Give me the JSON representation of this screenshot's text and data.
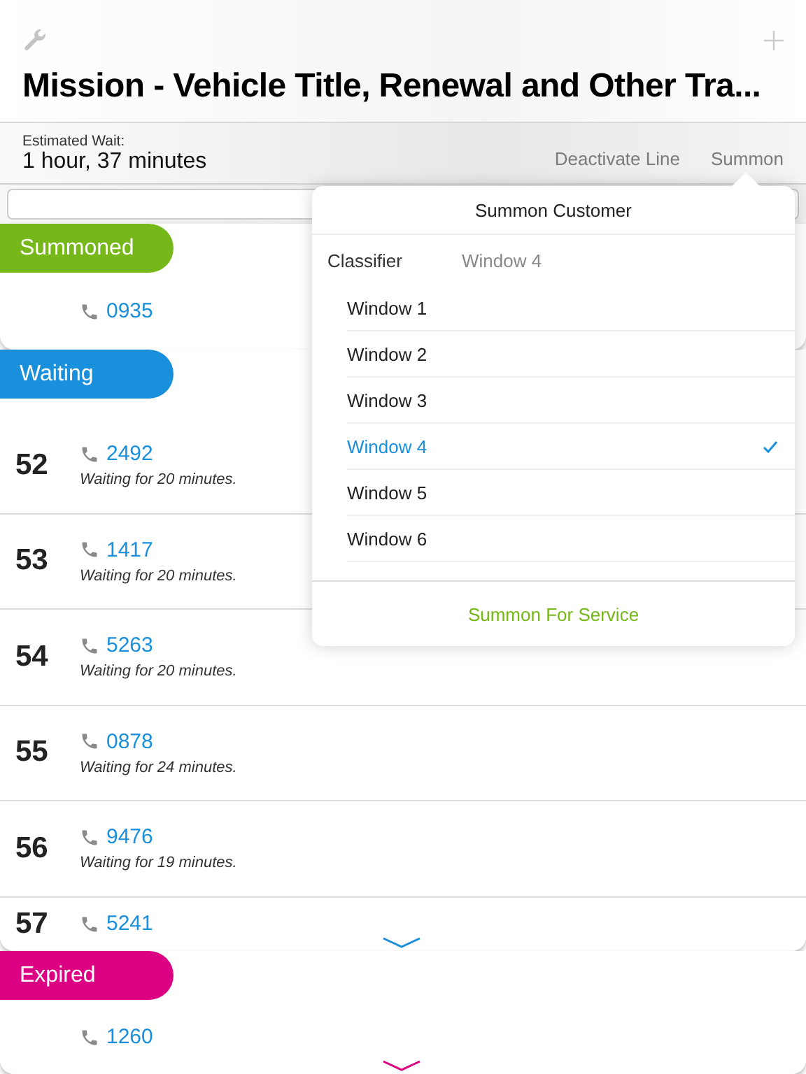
{
  "title": "Mission - Vehicle Title, Renewal and Other Tra...",
  "wait": {
    "label": "Estimated Wait:",
    "value": "1 hour, 37 minutes"
  },
  "actions": [
    "Deactivate Line",
    "Summon"
  ],
  "sections": [
    {
      "label": "Summoned",
      "color": "#76b71a",
      "rows": [
        {
          "phone": "0935"
        }
      ]
    },
    {
      "label": "Waiting",
      "color": "#1a8fdc",
      "rows": [
        {
          "number": "52",
          "phone": "2492",
          "note": "Waiting for 20 minutes."
        },
        {
          "number": "53",
          "phone": "1417",
          "note": "Waiting for 20 minutes."
        },
        {
          "number": "54",
          "phone": "5263",
          "note": "Waiting for 20 minutes."
        },
        {
          "number": "55",
          "phone": "0878",
          "note": "Waiting for 24 minutes."
        },
        {
          "number": "56",
          "phone": "9476",
          "note": "Waiting for 19 minutes."
        },
        {
          "number": "57",
          "phone": "5241"
        }
      ]
    },
    {
      "label": "Expired",
      "color": "#dc0082",
      "rows": [
        {
          "phone": "1260"
        }
      ]
    }
  ],
  "popover": {
    "title": "Summon Customer",
    "classifier": {
      "label": "Classifier",
      "value": "Window 4"
    },
    "options": [
      {
        "label": "Window 1",
        "selected": false
      },
      {
        "label": "Window 2",
        "selected": false
      },
      {
        "label": "Window 3",
        "selected": false
      },
      {
        "label": "Window 4",
        "selected": true
      },
      {
        "label": "Window 5",
        "selected": false
      },
      {
        "label": "Window 6",
        "selected": false
      }
    ],
    "button": "Summon For Service"
  }
}
